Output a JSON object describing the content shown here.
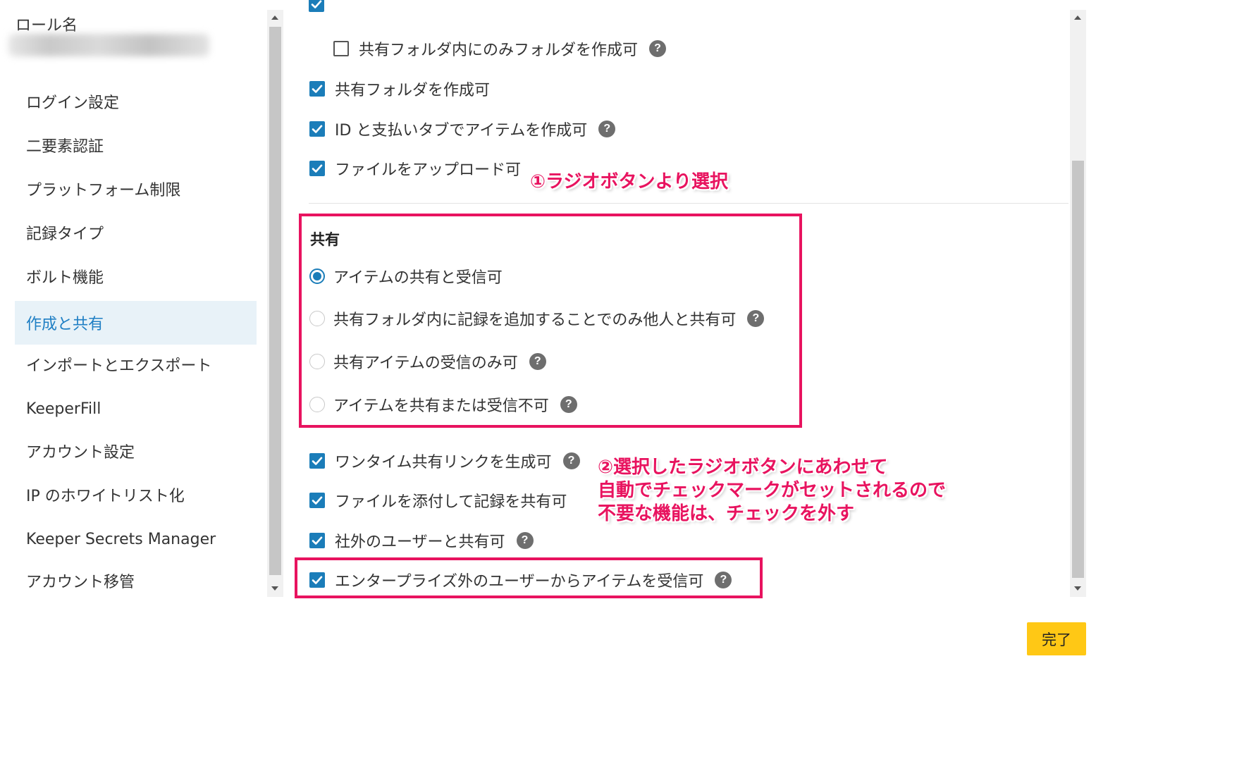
{
  "sidebar": {
    "role_label": "ロール名",
    "items": [
      {
        "label": "ログイン設定"
      },
      {
        "label": "二要素認証"
      },
      {
        "label": "プラットフォーム制限"
      },
      {
        "label": "記録タイプ"
      },
      {
        "label": "ボルト機能"
      },
      {
        "label": "作成と共有",
        "active": true
      },
      {
        "label": "インポートとエクスポート"
      },
      {
        "label": "KeeperFill"
      },
      {
        "label": "アカウント設定"
      },
      {
        "label": "IP のホワイトリスト化"
      },
      {
        "label": "Keeper Secrets Manager"
      },
      {
        "label": "アカウント移管"
      }
    ]
  },
  "creation": {
    "shared_folder_only": {
      "label": "共有フォルダ内にのみフォルダを作成可",
      "checked": false
    },
    "create_shared_folder": {
      "label": "共有フォルダを作成可",
      "checked": true
    },
    "id_payment_tab": {
      "label": "ID と支払いタブでアイテムを作成可",
      "checked": true
    },
    "file_upload": {
      "label": "ファイルをアップロード可",
      "checked": true
    }
  },
  "sharing": {
    "heading": "共有",
    "options": [
      {
        "label": "アイテムの共有と受信可",
        "selected": true
      },
      {
        "label": "共有フォルダ内に記録を追加することでのみ他人と共有可",
        "selected": false
      },
      {
        "label": "共有アイテムの受信のみ可",
        "selected": false
      },
      {
        "label": "アイテムを共有または受信不可",
        "selected": false
      }
    ],
    "one_time_link": {
      "label": "ワンタイム共有リンクを生成可",
      "checked": true
    },
    "attach_file_share": {
      "label": "ファイルを添付して記録を共有可",
      "checked": true
    },
    "share_external": {
      "label": "社外のユーザーと共有可",
      "checked": true
    },
    "receive_external": {
      "label": "エンタープライズ外のユーザーからアイテムを受信可",
      "checked": true
    }
  },
  "annotations": {
    "step1": "①ラジオボタンより選択",
    "step2_line1": "②選択したラジオボタンにあわせて",
    "step2_line2": "自動でチェックマークがセットされるので",
    "step2_line3": "不要な機能は、チェックを外す"
  },
  "footer": {
    "done_label": "完了"
  },
  "help_glyph": "?",
  "colors": {
    "accent": "#1b7db9",
    "active_nav_bg": "#e8f2f8",
    "active_nav_text": "#1f7fc4",
    "annotation": "#e8135f",
    "done_button": "#ffc815"
  }
}
